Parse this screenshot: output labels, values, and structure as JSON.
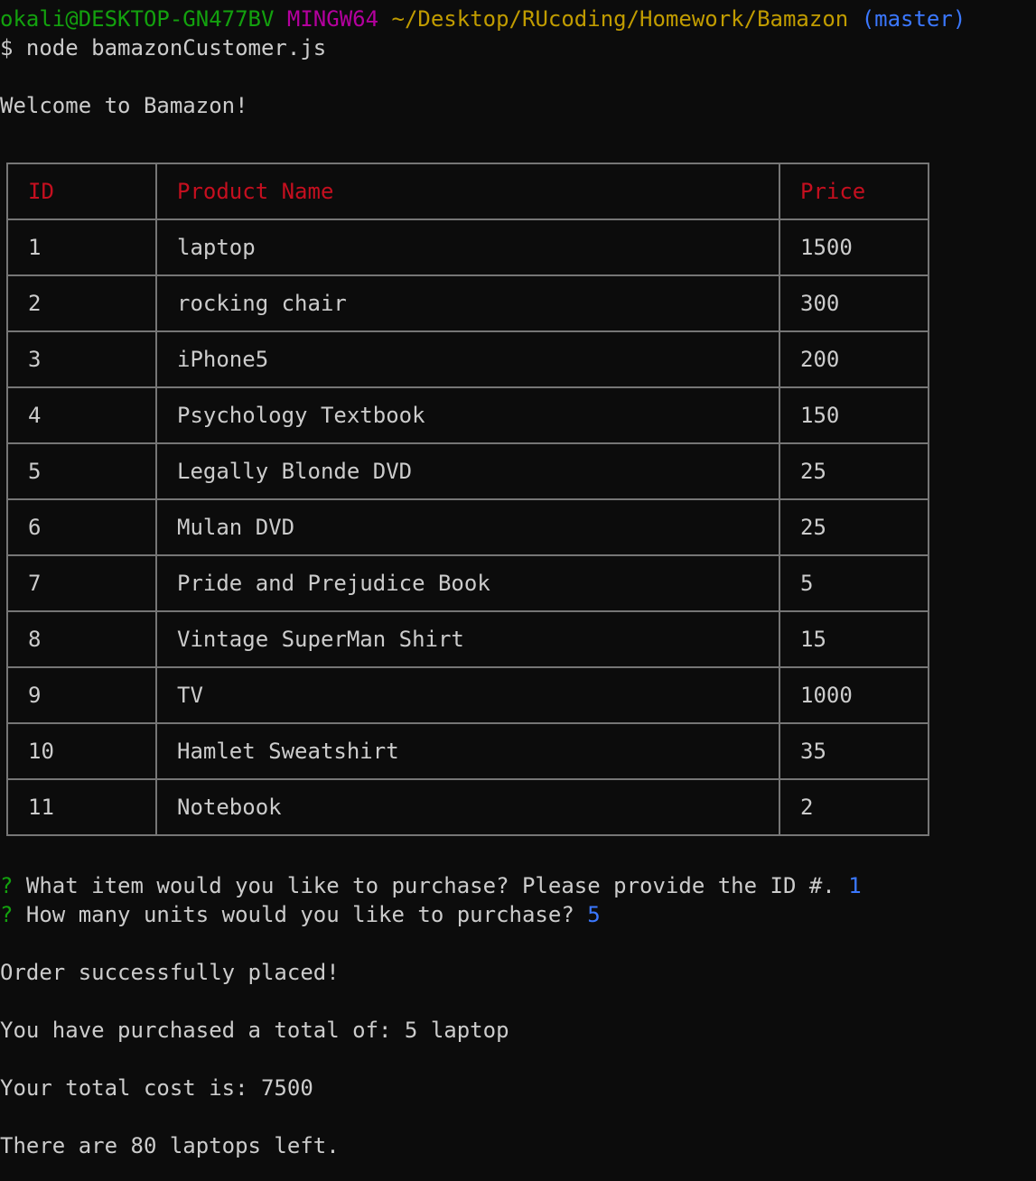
{
  "prompt": {
    "user_host": "okali@DESKTOP-GN477BV",
    "shell": "MINGW64",
    "path": "~/Desktop/RUcoding/Homework/Bamazon",
    "branch": "(master)",
    "command": "$ node bamazonCustomer.js"
  },
  "welcome": "Welcome to Bamazon!",
  "table": {
    "headers": [
      "ID",
      "Product Name",
      "Price"
    ],
    "rows": [
      [
        "1",
        "laptop",
        "1500"
      ],
      [
        "2",
        "rocking chair",
        "300"
      ],
      [
        "3",
        "iPhone5",
        "200"
      ],
      [
        "4",
        "Psychology Textbook",
        "150"
      ],
      [
        "5",
        "Legally Blonde DVD",
        "25"
      ],
      [
        "6",
        "Mulan DVD",
        "25"
      ],
      [
        "7",
        "Pride and Prejudice Book",
        "5"
      ],
      [
        "8",
        "Vintage SuperMan Shirt",
        "15"
      ],
      [
        "9",
        "TV",
        "1000"
      ],
      [
        "10",
        "Hamlet Sweatshirt",
        "35"
      ],
      [
        "11",
        "Notebook",
        "2"
      ]
    ]
  },
  "questions": [
    {
      "mark": "?",
      "text": "What item would you like to purchase? Please provide the ID #.",
      "answer": "1"
    },
    {
      "mark": "?",
      "text": "How many units would you like to purchase?",
      "answer": "5"
    }
  ],
  "output": {
    "order_status": "Order successfully placed!",
    "purchase_summary": "You have purchased a total of: 5 laptop",
    "total_cost": "Your total cost is: 7500",
    "stock_left": "There are 80 laptops left."
  },
  "colors": {
    "background": "#0c0c0c",
    "foreground": "#cccccc",
    "user_host": "#13a10e",
    "shell": "#b4009e",
    "path": "#c19c00",
    "branch": "#3b78ff",
    "table_header": "#c50f1f",
    "table_border": "#767676",
    "question_mark": "#13a10e",
    "answer": "#3b78ff"
  }
}
